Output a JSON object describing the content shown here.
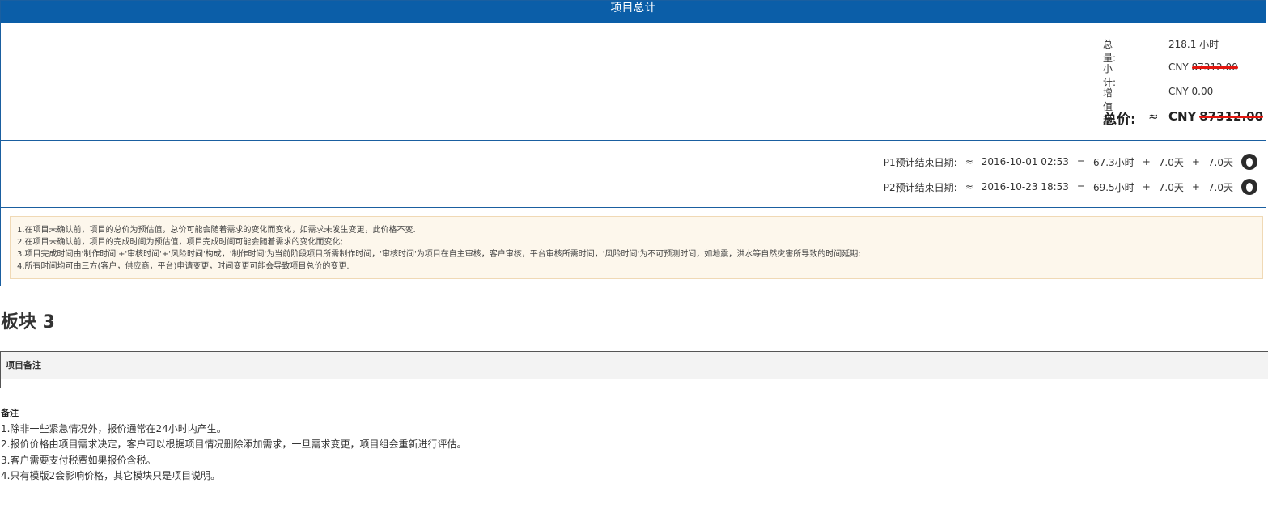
{
  "summary_panel": {
    "title": "项目总计",
    "rows": {
      "total_qty": {
        "label": "总量:",
        "value": "218.1 小时"
      },
      "subtotal": {
        "label": "小计:",
        "currency": "CNY",
        "value": "87312.00"
      },
      "vat": {
        "label": "增值税:",
        "value": "CNY 0.00"
      },
      "total_price": {
        "label": "总价:",
        "approx": "≈",
        "currency": "CNY",
        "value": "87312.00"
      }
    }
  },
  "dates": [
    {
      "label": "P1预计结束日期:",
      "approx": "≈",
      "date": "2016-10-01 02:53",
      "eq": "=",
      "a": "67.3小时",
      "plus1": "+",
      "b": "7.0天",
      "plus2": "+",
      "c": "7.0天"
    },
    {
      "label": "P2预计结束日期:",
      "approx": "≈",
      "date": "2016-10-23 18:53",
      "eq": "=",
      "a": "69.5小时",
      "plus1": "+",
      "b": "7.0天",
      "plus2": "+",
      "c": "7.0天"
    }
  ],
  "notice_lines": [
    "1.在项目未确认前，项目的总价为预估值，总价可能会随着需求的变化而变化，如需求未发生变更，此价格不变.",
    "2.在项目未确认前，项目的完成时间为预估值，项目完成时间可能会随着需求的变化而变化;",
    "3.项目完成时间由'制作时间'+'审核时间'+'风险时间'构成，'制作时间'为当前阶段项目所需制作时间，'审核时间'为项目在自主审核，客户审核，平台审核所需时间，'风险时间'为不可预测时间，如地震，洪水等自然灾害所导致的时间延期;",
    "4.所有时间均可由三方(客户，供应商，平台)申请变更，时间变更可能会导致项目总价的变更."
  ],
  "section3": {
    "title": "板块 3",
    "table_header": "项目备注"
  },
  "remarks": {
    "title": "备注",
    "lines": [
      "1.除非一些紧急情况外，报价通常在24小时内产生。",
      "2.报价价格由项目需求决定，客户可以根据项目情况删除添加需求，一旦需求变更，项目组会重新进行评估。",
      "3.客户需要支付税费如果报价含税。",
      "4.只有模版2会影响价格，其它模块只是项目说明。"
    ]
  },
  "colors": {
    "header_bg": "#0b5ea8",
    "border": "#1a5fa0",
    "strike": "#e3160f",
    "notice_bg": "#fdf7ec"
  }
}
